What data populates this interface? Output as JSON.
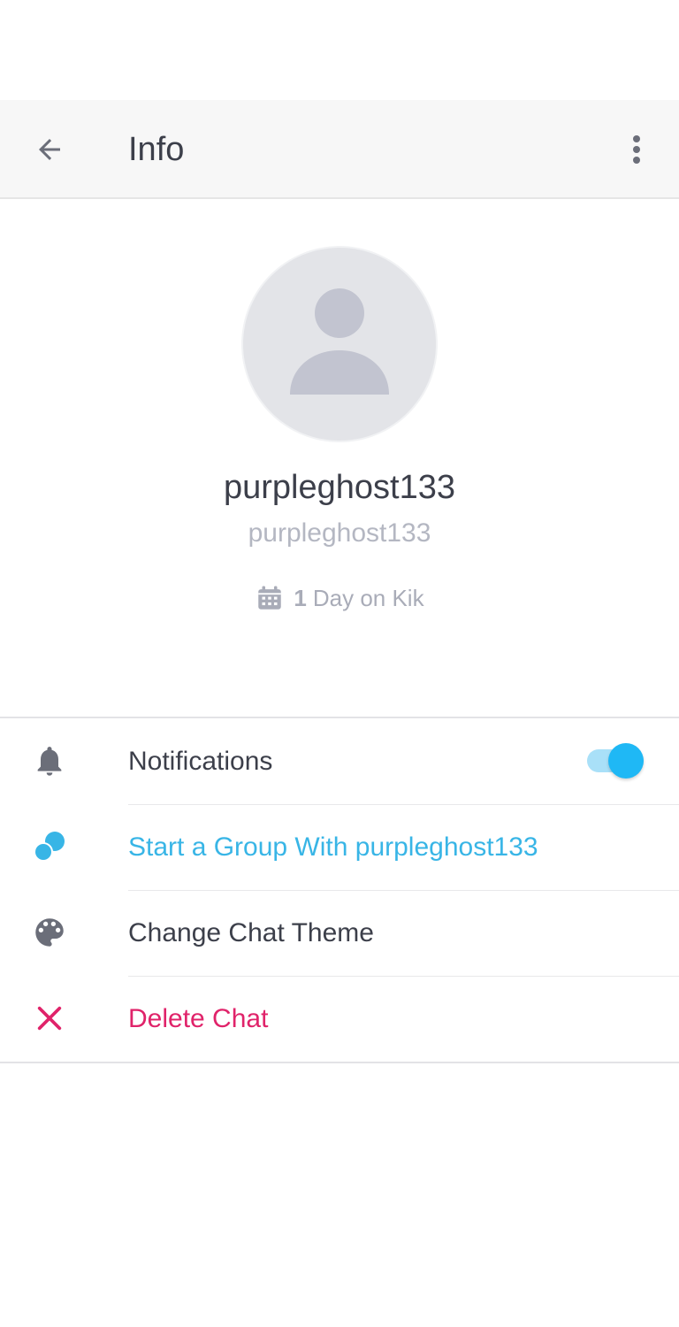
{
  "toolbar": {
    "title": "Info",
    "back_icon": "arrow-left-icon",
    "more_icon": "more-vertical-icon"
  },
  "profile": {
    "avatar_icon": "person-placeholder-icon",
    "display_name": "purpleghost133",
    "username": "purpleghost133",
    "days_count": "1",
    "days_text": "Day on Kik",
    "calendar_icon": "calendar-icon"
  },
  "menu": {
    "notifications": {
      "label": "Notifications",
      "icon": "bell-icon",
      "toggle_on": true
    },
    "start_group": {
      "label": "Start a Group With purpleghost133",
      "icon": "group-bubbles-icon"
    },
    "change_theme": {
      "label": "Change Chat Theme",
      "icon": "palette-icon"
    },
    "delete_chat": {
      "label": "Delete Chat",
      "icon": "close-icon"
    }
  },
  "colors": {
    "accent_blue": "#38b5e6",
    "toggle_blue": "#1fb8f5",
    "danger_red": "#e0236a",
    "text_dark": "#3c3f4a",
    "text_muted": "#b4b7c2"
  }
}
